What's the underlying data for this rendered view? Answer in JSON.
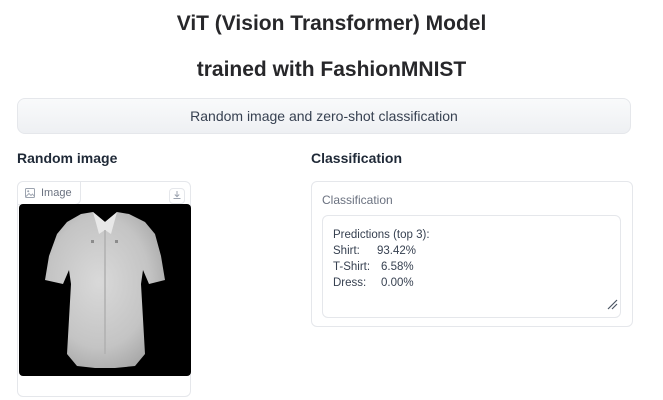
{
  "header": {
    "title_line1": "ViT (Vision Transformer) Model",
    "title_line2": "trained with FashionMNIST"
  },
  "actions": {
    "run_label": "Random image and zero-shot classification"
  },
  "image_section": {
    "heading": "Random image",
    "tag_label": "Image",
    "tag_icon": "image-icon",
    "download_icon": "download-icon"
  },
  "classification_section": {
    "heading": "Classification",
    "field_label": "Classification",
    "header_line": "Predictions (top 3):",
    "predictions": [
      {
        "name": "Shirt:",
        "value": "93.42%"
      },
      {
        "name": "T-Shirt:",
        "value": "6.58%"
      },
      {
        "name": "Dress:",
        "value": "0.00%"
      }
    ]
  },
  "colors": {
    "border": "#e5e7eb",
    "muted_text": "#6b7280",
    "button_bg": "#f3f4f6",
    "image_bg": "#000000"
  }
}
